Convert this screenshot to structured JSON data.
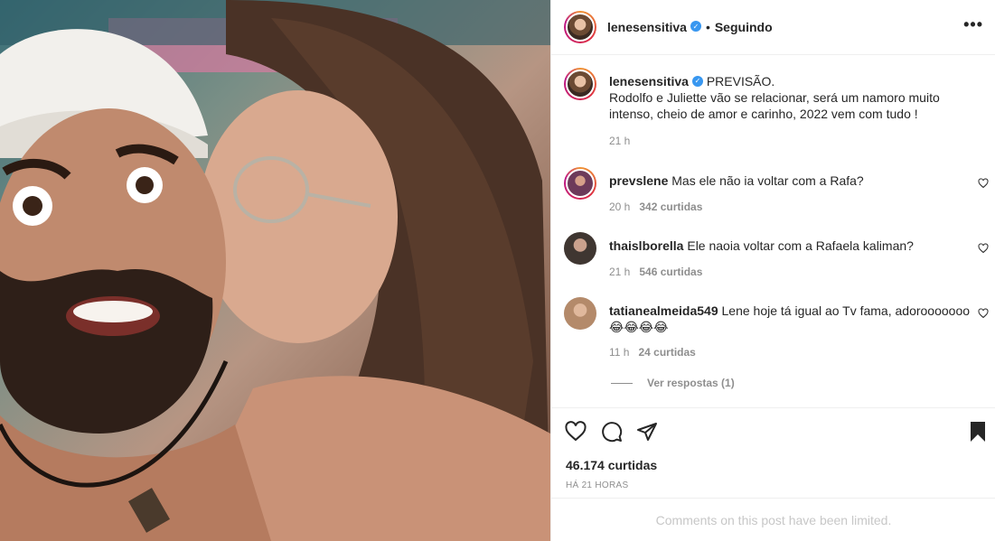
{
  "header": {
    "username": "lenesensitiva",
    "dot": "•",
    "follow_status": "Seguindo",
    "more": "•••"
  },
  "caption": {
    "username": "lenesensitiva",
    "text": "PREVISÃO.",
    "text2": "Rodolfo e Juliette vão se relacionar, será um namoro muito intenso, cheio de amor e carinho, 2022 vem com tudo !",
    "time": "21 h"
  },
  "comments": [
    {
      "username": "prevslene",
      "text": "Mas ele não ia voltar com a Rafa?",
      "time": "20 h",
      "likes": "342 curtidas"
    },
    {
      "username": "thaislborella",
      "text": "Ele naoia voltar com a Rafaela kaliman?",
      "time": "21 h",
      "likes": "546 curtidas"
    },
    {
      "username": "tatianealmeida549",
      "text": "Lene hoje tá igual ao Tv fama, adorooooooo😂😂😂😂",
      "time": "11 h",
      "likes": "24 curtidas"
    }
  ],
  "view_replies": "Ver respostas (1)",
  "likes_total": "46.174 curtidas",
  "posted": "HÁ 21 HORAS",
  "comments_limited": "Comments on this post have been limited.",
  "icons": {
    "like": "heart-icon",
    "comment": "comment-icon",
    "share": "paper-plane-icon",
    "save": "bookmark-icon",
    "verified": "verified-badge-icon"
  },
  "colors": {
    "text": "#262626",
    "muted": "#8e8e8e",
    "verified": "#3897f0",
    "border": "#efefef"
  }
}
